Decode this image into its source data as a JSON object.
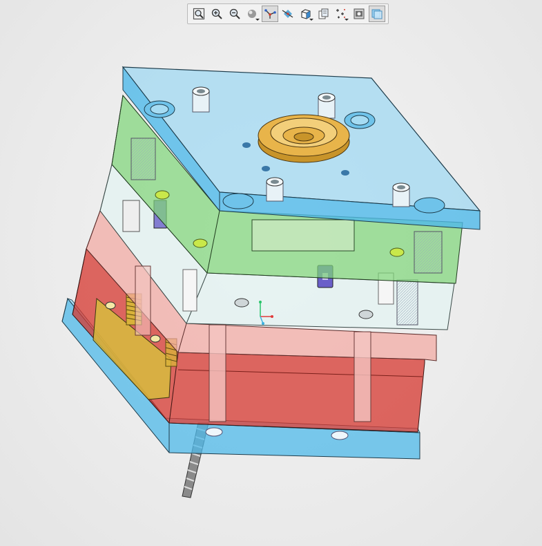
{
  "toolbar": {
    "buttons": [
      {
        "name": "refit-button",
        "icon": "refit-icon",
        "active": false,
        "dropdown": false
      },
      {
        "name": "zoom-in-button",
        "icon": "zoom-in-icon",
        "active": false,
        "dropdown": false
      },
      {
        "name": "zoom-out-button",
        "icon": "zoom-out-icon",
        "active": false,
        "dropdown": false
      },
      {
        "name": "display-style-button",
        "icon": "display-style-icon",
        "active": false,
        "dropdown": true
      },
      {
        "name": "datum-display-button",
        "icon": "datum-axes-icon",
        "active": true,
        "dropdown": false
      },
      {
        "name": "spin-center-button",
        "icon": "spin-center-icon",
        "active": false,
        "dropdown": false
      },
      {
        "name": "saved-views-button",
        "icon": "saved-views-icon",
        "active": false,
        "dropdown": true
      },
      {
        "name": "view-manager-button",
        "icon": "view-manager-icon",
        "active": false,
        "dropdown": false
      },
      {
        "name": "annotations-button",
        "icon": "annotations-icon",
        "active": false,
        "dropdown": true
      },
      {
        "name": "appearance-button",
        "icon": "appearance-icon",
        "active": false,
        "dropdown": false
      },
      {
        "name": "transparency-button",
        "icon": "transparency-icon",
        "active": true,
        "dropdown": false
      }
    ]
  },
  "model": {
    "description_icon": "mold-assembly-icon",
    "colors": {
      "top_clamp_plate": "#4fb9ea",
      "a_plate": "#7fd67a",
      "b_plate": "#d8ece9",
      "support_plate": "#f2a6a0",
      "ejector_housing": "#d6372f",
      "bottom_clamp_plate": "#4fb9ea",
      "locating_ring": "#e8b44a",
      "ejector_plate": "#d7c23c"
    }
  }
}
